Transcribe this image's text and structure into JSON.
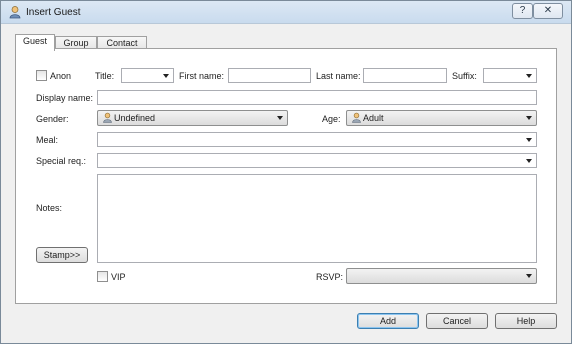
{
  "window": {
    "title": "Insert Guest",
    "help_label": "?",
    "close_label": "✕"
  },
  "tabs": [
    {
      "label": "Guest",
      "active": true
    },
    {
      "label": "Group",
      "active": false
    },
    {
      "label": "Contact",
      "active": false
    }
  ],
  "form": {
    "anon_label": "Anon",
    "title_label": "Title:",
    "first_name_label": "First name:",
    "last_name_label": "Last name:",
    "suffix_label": "Suffix:",
    "display_name_label": "Display name:",
    "gender_label": "Gender:",
    "gender_value": "Undefined",
    "age_label": "Age:",
    "age_value": "Adult",
    "meal_label": "Meal:",
    "special_req_label": "Special req.:",
    "notes_label": "Notes:",
    "stamp_label": "Stamp>>",
    "vip_label": "VIP",
    "rsvp_label": "RSVP:"
  },
  "buttons": {
    "add": "Add",
    "cancel": "Cancel",
    "help": "Help"
  },
  "icons": {
    "window": "person-icon",
    "gender": "person-icon",
    "age": "person-icon"
  },
  "colors": {
    "title_bg": "#dce8f4",
    "default_button_border": "#3c7fb1"
  }
}
